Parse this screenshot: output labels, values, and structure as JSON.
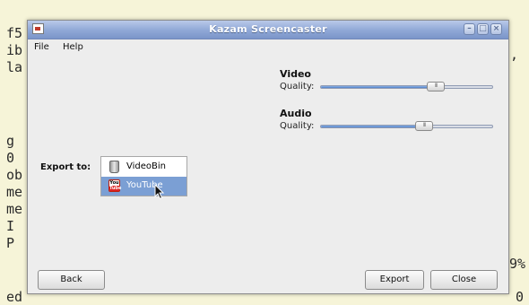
{
  "background_terminal": {
    "left_lines": [
      "f5",
      "ib",
      "la",
      "g",
      "0",
      "ob",
      "me",
      "me",
      "I",
      "P",
      "ed"
    ],
    "right_fragments": [
      ",",
      "9%",
      "0"
    ]
  },
  "window": {
    "title": "Kazam Screencaster",
    "controls": {
      "minimize": "–",
      "maximize": "□",
      "close": "×"
    }
  },
  "menu": {
    "items": [
      "File",
      "Help"
    ]
  },
  "video": {
    "heading": "Video",
    "quality_label": "Quality:",
    "quality_value": 0.67
  },
  "audio": {
    "heading": "Audio",
    "quality_label": "Quality:",
    "quality_value": 0.6
  },
  "export": {
    "label": "Export to:",
    "options": [
      {
        "label": "VideoBin",
        "icon": "videobin-icon",
        "selected": false
      },
      {
        "label": "YouTube",
        "icon": "youtube-icon",
        "selected": true
      }
    ],
    "youtube_icon_text": {
      "top": "You",
      "bottom": "Tube"
    }
  },
  "buttons": {
    "back": "Back",
    "export": "Export",
    "close": "Close"
  }
}
